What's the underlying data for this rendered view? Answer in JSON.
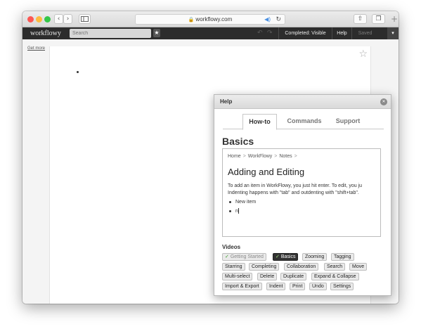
{
  "browser": {
    "url": "workflowy.com",
    "icons": {
      "back": "chevron-left-icon",
      "forward": "chevron-right-icon",
      "sidebar": "sidebar-icon",
      "lock": "lock-icon",
      "audio": "speaker-icon",
      "reload": "reload-icon",
      "share": "share-icon",
      "tabs": "tabs-icon",
      "new_tab": "plus-icon"
    },
    "traffic_lights": [
      "#fc5753",
      "#fdbc40",
      "#33c748"
    ]
  },
  "appbar": {
    "logo": "workflowy",
    "search_placeholder": "Search",
    "star_glyph": "★",
    "undo_glyph": "↶",
    "redo_glyph": "↷",
    "completed": "Completed: Visible",
    "help": "Help",
    "saved": "Saved",
    "caret": "▾"
  },
  "sidebar": {
    "get_more": "Get more"
  },
  "help": {
    "title": "Help",
    "tabs": [
      "How-to",
      "Commands",
      "Support"
    ],
    "active_tab": "How-to",
    "section": "Basics",
    "breadcrumb": [
      "Home",
      "WorkFlowy",
      "Notes"
    ],
    "heading": "Adding and Editing",
    "paragraph_line1": "To add an item in WorkFlowy, you just hit enter. To edit, you ju",
    "paragraph_line2": "Indenting happens with \"tab\" and outdenting with \"shift+tab\".",
    "list": [
      "New item",
      "n"
    ],
    "videos_label": "Videos",
    "videos": [
      {
        "label": "Getting Started",
        "state": "done"
      },
      {
        "label": "Basics",
        "state": "active"
      },
      {
        "label": "Zooming",
        "state": "normal"
      },
      {
        "label": "Tagging",
        "state": "normal"
      },
      {
        "label": "Starring",
        "state": "normal"
      },
      {
        "label": "Completing",
        "state": "normal"
      },
      {
        "label": "Collaboration",
        "state": "normal"
      },
      {
        "label": "Search",
        "state": "normal"
      },
      {
        "label": "Move",
        "state": "normal"
      },
      {
        "label": "Multi-select",
        "state": "normal"
      },
      {
        "label": "Delete",
        "state": "normal"
      },
      {
        "label": "Duplicate",
        "state": "normal"
      },
      {
        "label": "Expand & Collapse",
        "state": "normal"
      },
      {
        "label": "Import & Export",
        "state": "normal"
      },
      {
        "label": "Indent",
        "state": "normal"
      },
      {
        "label": "Print",
        "state": "normal"
      },
      {
        "label": "Undo",
        "state": "normal"
      },
      {
        "label": "Settings",
        "state": "normal"
      }
    ]
  }
}
